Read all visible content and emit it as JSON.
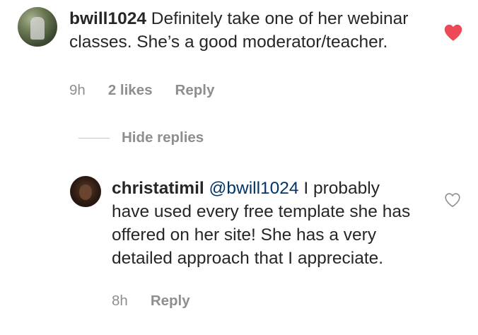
{
  "comment": {
    "username": "bwill1024",
    "text": " Definitely take one of her webinar classes. She’s a good moderator/teacher.",
    "time": "9h",
    "likes": "2 likes",
    "reply_label": "Reply",
    "liked": true
  },
  "replies_toggle": {
    "label": "Hide replies"
  },
  "reply": {
    "username": "christatimil",
    "mention": "@bwill1024",
    "text": " I probably have used every free template she has offered on her site! She has a very detailed approach that I appreciate.",
    "time": "8h",
    "reply_label": "Reply",
    "liked": false
  },
  "colors": {
    "text": "#262626",
    "meta": "#8e8e8e",
    "mention": "#003569",
    "heart_liked": "#ed4956",
    "heart_outline": "#8e8e8e"
  },
  "icons": {
    "liked_heart": "heart-filled-icon",
    "unliked_heart": "heart-outline-icon"
  }
}
